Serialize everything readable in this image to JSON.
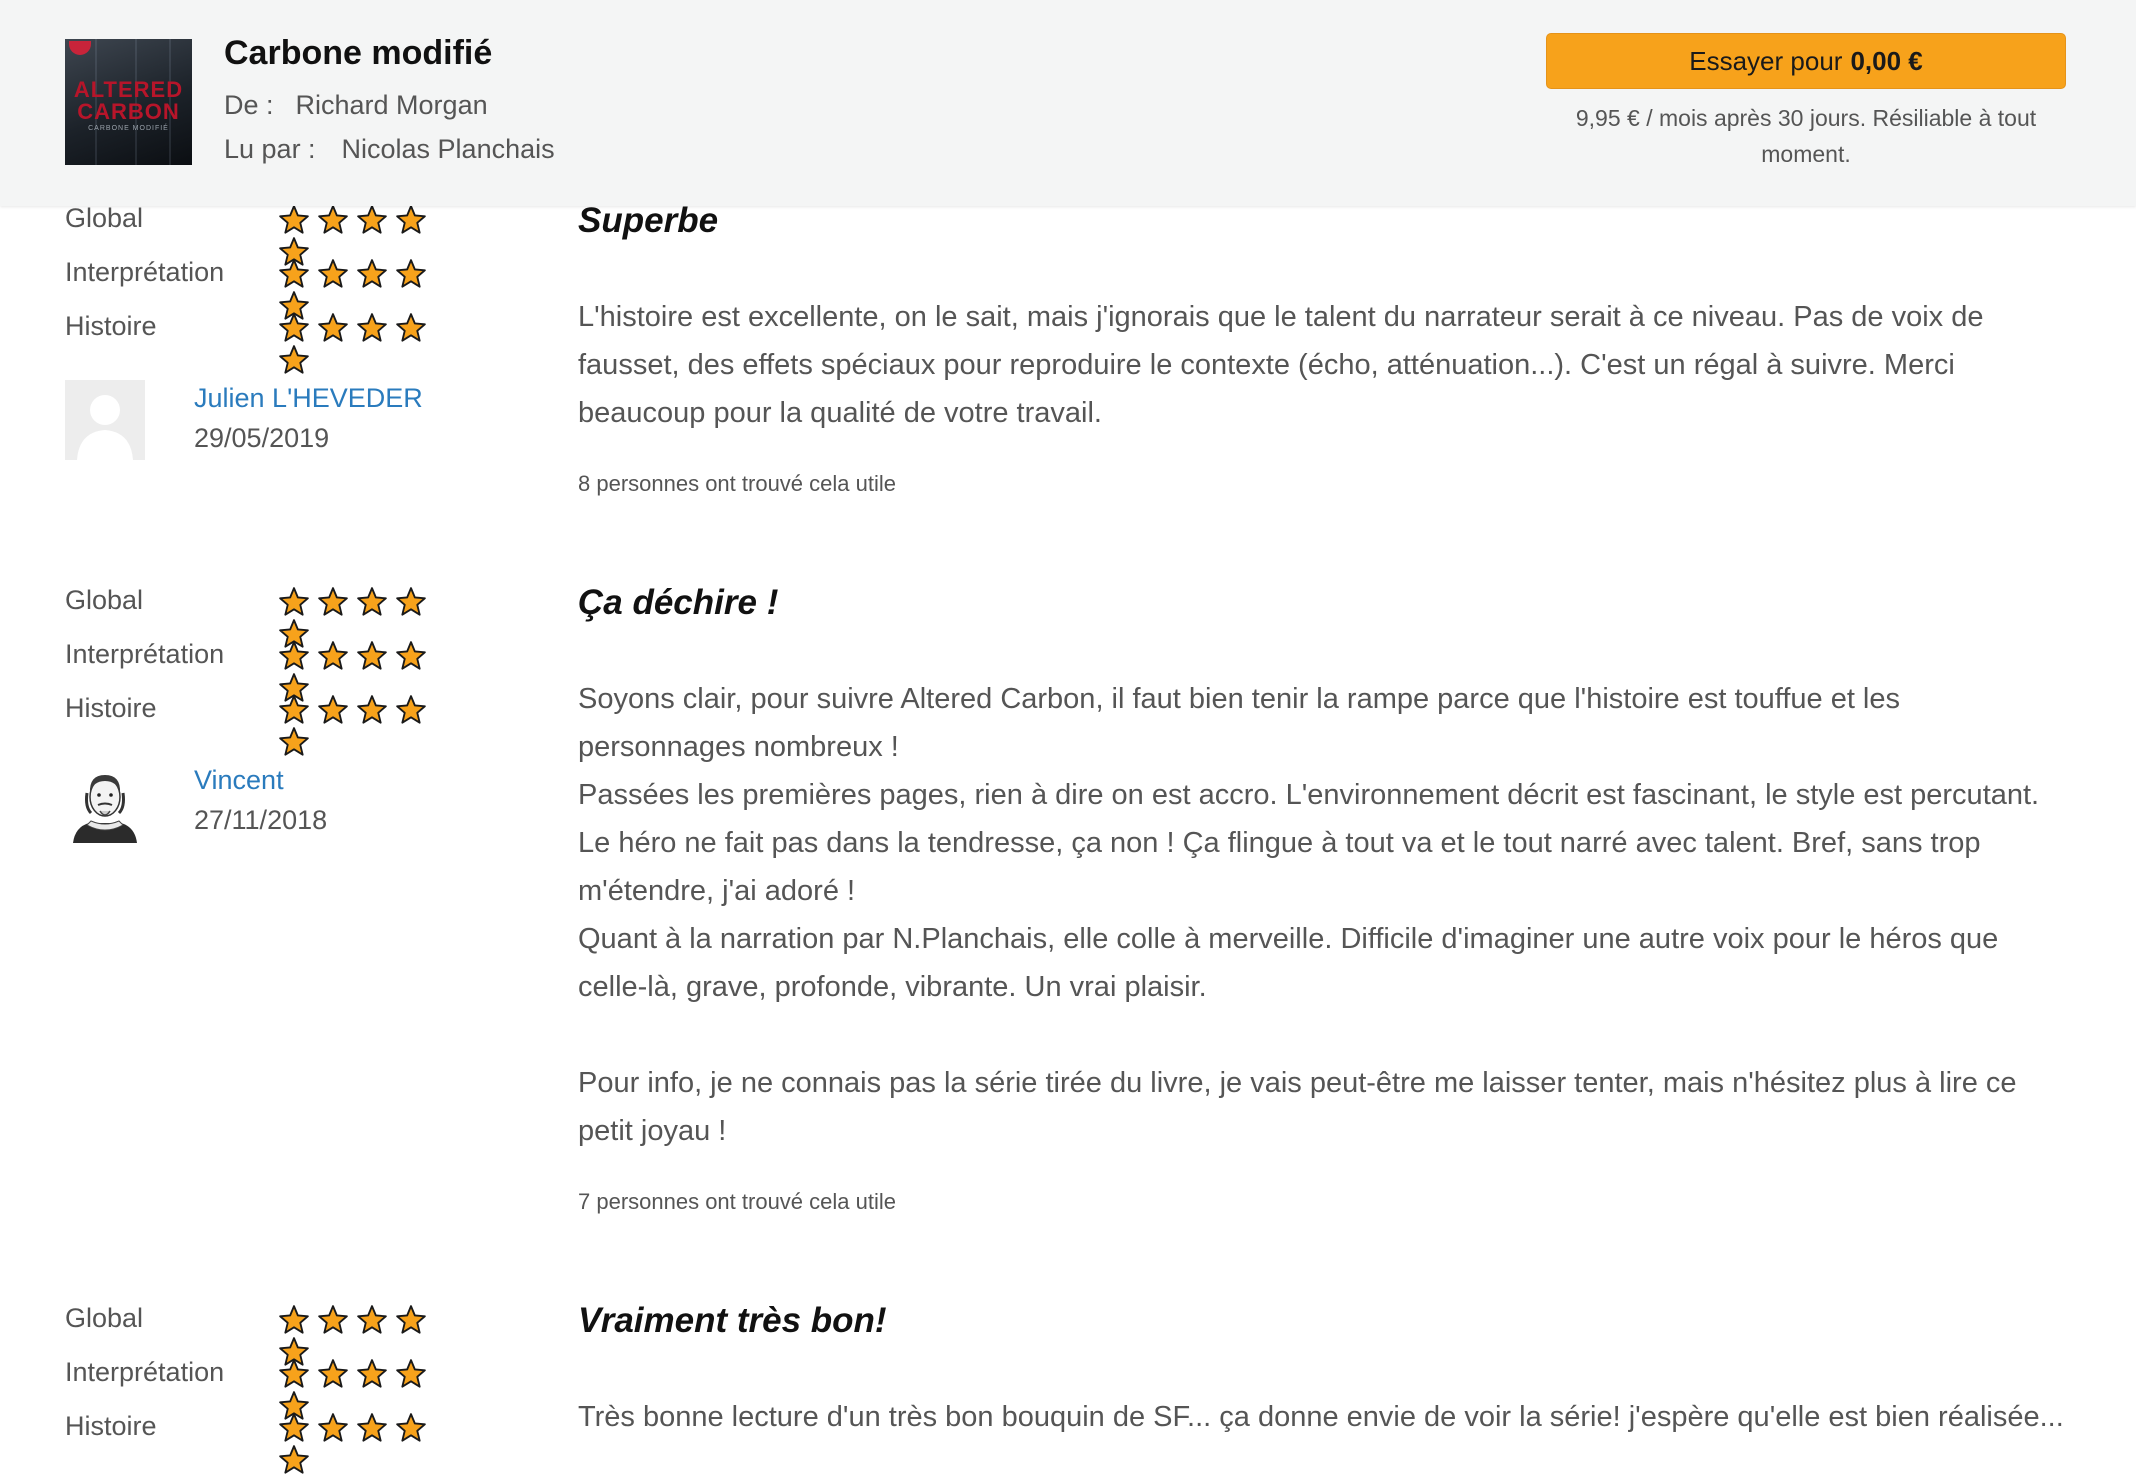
{
  "header": {
    "book_title": "Carbone modifié",
    "author_label": "De :",
    "author": "Richard Morgan",
    "narrator_label": "Lu par :",
    "narrator": "Nicolas Planchais",
    "cover": {
      "line1": "ALTERED",
      "line2": "CARBON",
      "subtitle": "CARBONE MODIFIÉ"
    },
    "cta_prefix": "Essayer pour",
    "cta_price": "0,00 €",
    "cta_note": "9,95 € / mois après 30 jours. Résiliable à tout moment.",
    "colors": {
      "cta": "#f7a21b",
      "link": "#2a7bbd"
    }
  },
  "rating_labels": {
    "global": "Global",
    "performance": "Interprétation",
    "story": "Histoire"
  },
  "reviews": [
    {
      "ratings": {
        "global": 5,
        "performance": 5,
        "story": 5
      },
      "reviewer": "Julien L'HEVEDER",
      "date": "29/05/2019",
      "avatar": "default-person-icon",
      "title": "Superbe",
      "body": [
        "L'histoire est excellente, on le sait, mais j'ignorais que le talent du narrateur serait à ce niveau. Pas de voix de fausset, des effets spéciaux pour reproduire le contexte (écho, atténuation...). C'est un régal à suivre. Merci beaucoup pour la qualité de votre travail."
      ],
      "helpful": "8 personnes ont trouvé cela utile"
    },
    {
      "ratings": {
        "global": 5,
        "performance": 5,
        "story": 5
      },
      "reviewer": "Vincent",
      "date": "27/11/2018",
      "avatar": "shakespeare-portrait",
      "title": "Ça déchire !",
      "body": [
        "Soyons clair, pour suivre Altered Carbon, il faut bien tenir la rampe parce que l'histoire est touffue et les personnages nombreux !\nPassées les premières pages, rien à dire on est accro. L'environnement décrit est fascinant, le style est percutant. Le héro ne fait pas dans la tendresse, ça non ! Ça flingue à tout va et le tout narré avec talent. Bref, sans trop m'étendre, j'ai adoré !\nQuant à la narration par N.Planchais, elle colle à merveille. Difficile d'imaginer une autre voix pour le héros que celle-là, grave, profonde, vibrante. Un vrai plaisir.",
        "Pour info, je ne connais pas la série tirée du livre, je vais peut-être me laisser tenter, mais n'hésitez plus à lire ce petit joyau !"
      ],
      "helpful": "7 personnes ont trouvé cela utile"
    },
    {
      "ratings": {
        "global": 5,
        "performance": 5,
        "story": 5
      },
      "title": "Vraiment très bon!",
      "body": [
        "Très bonne lecture d'un très bon bouquin de SF... ça donne envie de voir la série! j'espère qu'elle est bien réalisée..."
      ]
    }
  ]
}
